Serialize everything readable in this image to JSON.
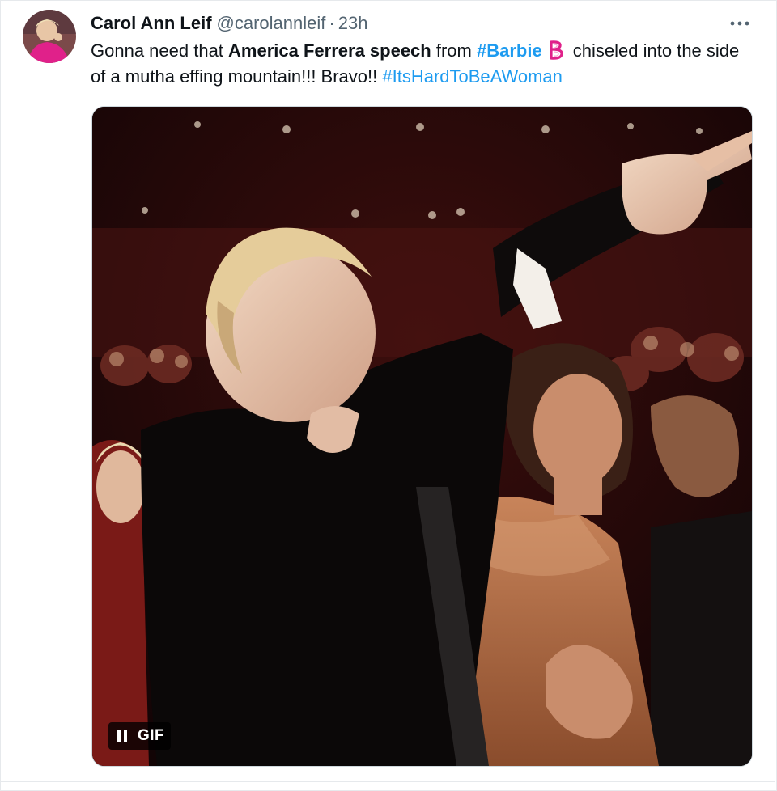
{
  "tweet": {
    "author_name": "Carol Ann Leif",
    "handle": "@carolannleif",
    "separator": "·",
    "time": "23h",
    "more_icon": "ellipsis-icon",
    "text": {
      "part1": "Gonna need that ",
      "bold": "America Ferrera speech",
      "part2": " from ",
      "hashtag1": "#Barbie",
      "emoji": "barbie-b-emoji",
      "part3": " chiseled into the side of a mutha effing mountain!!! Bravo!! ",
      "hashtag2": "#ItsHardToBeAWoman"
    },
    "media": {
      "badge": "GIF",
      "pause_icon": "pause-icon"
    }
  },
  "colors": {
    "link": "#1d9bf0",
    "secondary": "#536471",
    "primary_text": "#0f1419",
    "barbie_pink": "#e0218a"
  }
}
